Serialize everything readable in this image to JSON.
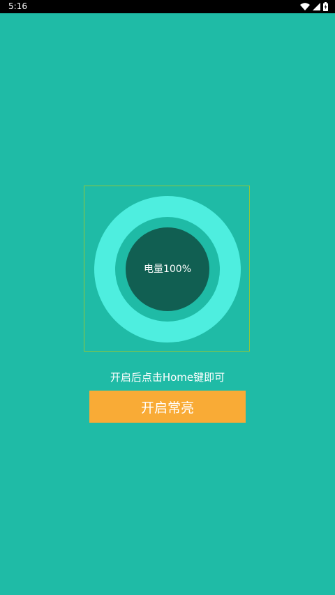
{
  "status_bar": {
    "time": "5:16",
    "icons": [
      "wifi-icon",
      "signal-icon",
      "battery-charging-icon"
    ]
  },
  "battery": {
    "label": "电量100%",
    "level_percent": 100
  },
  "hint": {
    "text": "开启后点击Home键即可"
  },
  "action": {
    "label": "开启常亮"
  },
  "colors": {
    "background": "#1FBBA6",
    "ring_outer": "#4EEEDF",
    "ring_inner": "#115F52",
    "frame_border": "#8DC63F",
    "button": "#F9AB36",
    "text": "#FFFFFF"
  }
}
